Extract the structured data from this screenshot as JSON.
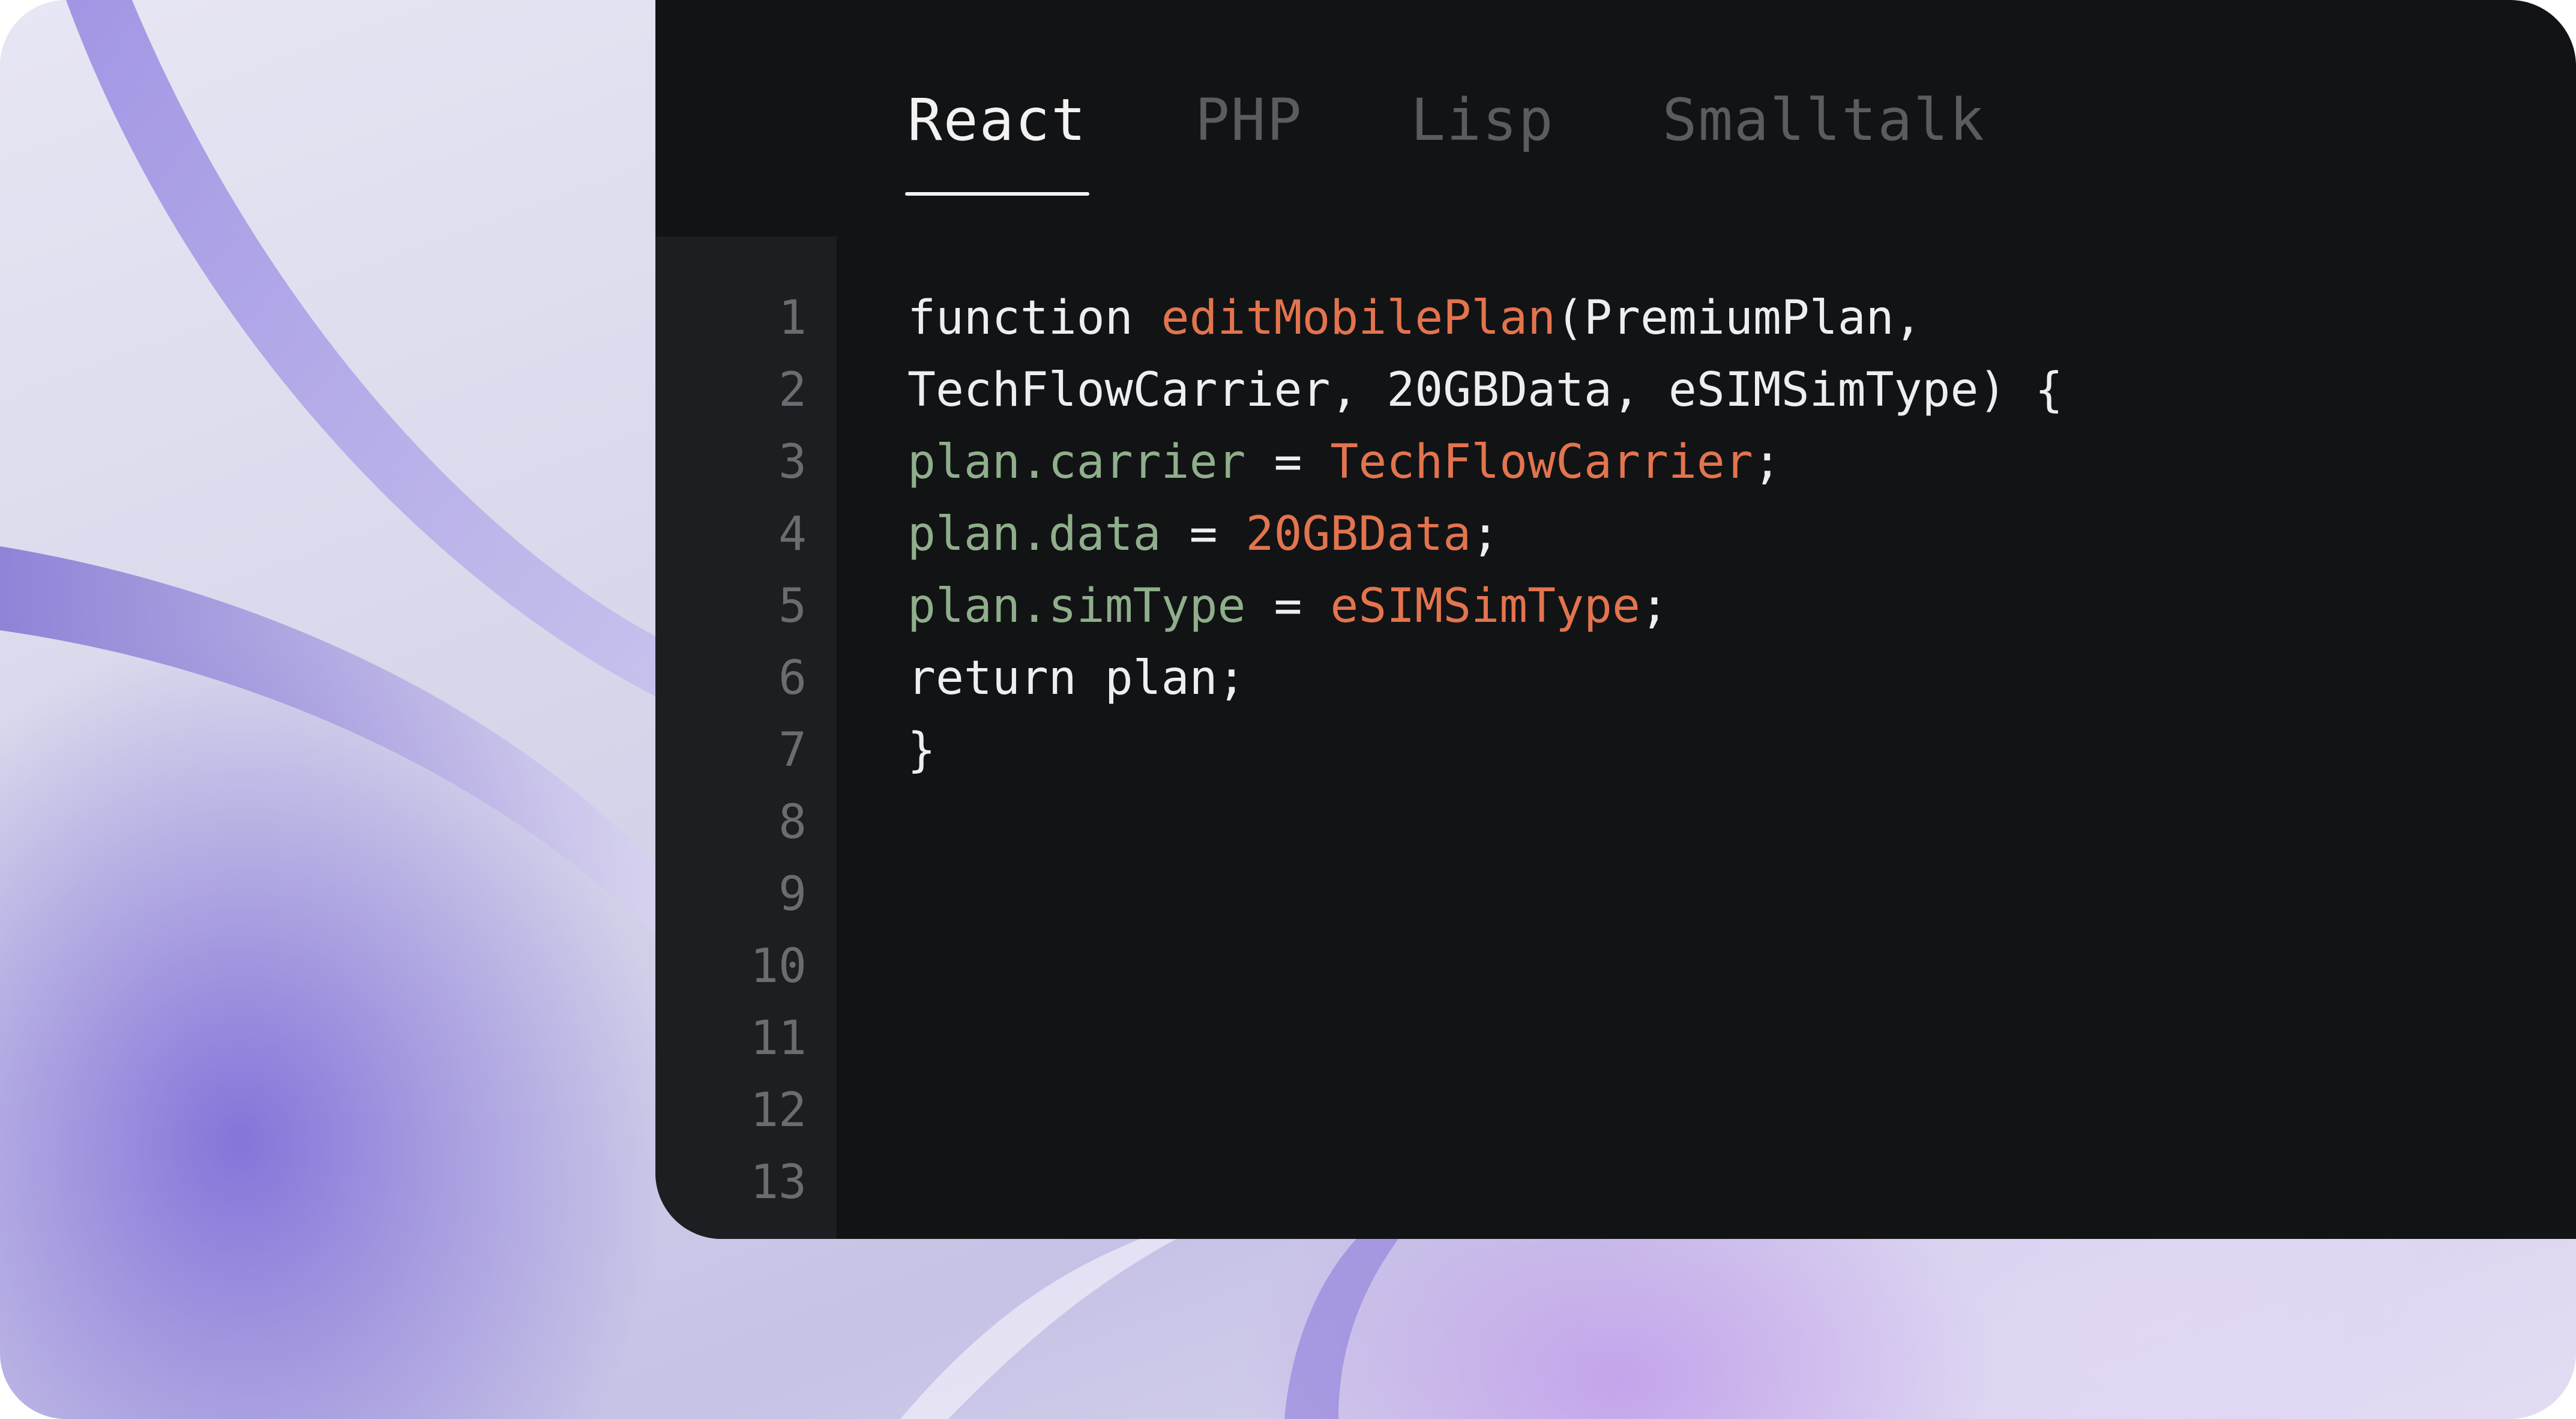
{
  "tabs": [
    {
      "label": "React",
      "active": true
    },
    {
      "label": "PHP",
      "active": false
    },
    {
      "label": "Lisp",
      "active": false
    },
    {
      "label": "Smalltalk",
      "active": false
    }
  ],
  "line_numbers": [
    "1",
    "2",
    "3",
    "4",
    "5",
    "6",
    "7",
    "8",
    "9",
    "10",
    "11",
    "12",
    "13"
  ],
  "code": {
    "line1": {
      "kw": "function ",
      "fn": "editMobilePlan",
      "rest": "(PremiumPlan,"
    },
    "line2": {
      "text": "TechFlowCarrier, 20GBData, eSIMSimType) {"
    },
    "line3": {
      "prop": "plan.carrier",
      "op": " = ",
      "val": "TechFlowCarrier",
      "end": ";"
    },
    "line4": {
      "prop": "plan.data",
      "op": " = ",
      "val": "20GBData",
      "end": ";"
    },
    "line5": {
      "prop": "plan.simType",
      "op": " = ",
      "val": "eSIMSimType",
      "end": ";"
    },
    "line6": {
      "text": "return plan;"
    },
    "line7": {
      "text": "}"
    }
  },
  "colors": {
    "editor_bg": "#121315",
    "gutter_bg": "#1d1e21",
    "function_name": "#e2744e",
    "property": "#8fae8b",
    "value": "#e2744e",
    "text": "#eceef0",
    "inactive_tab": "#5a5c60"
  }
}
